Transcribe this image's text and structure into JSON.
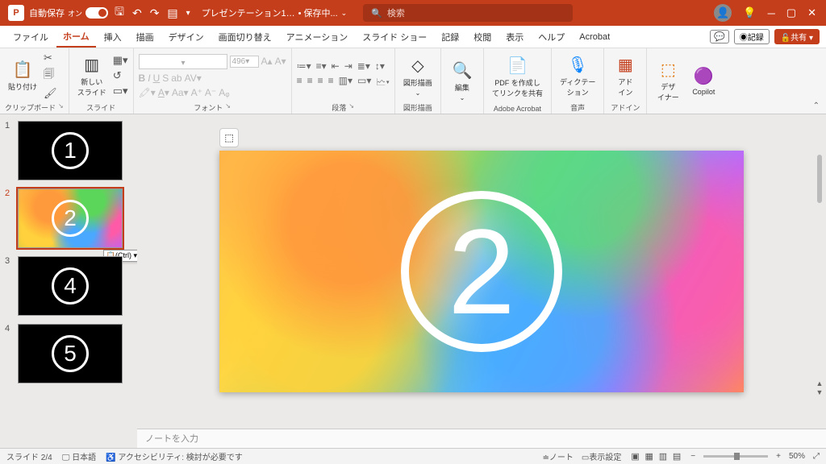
{
  "title_bar": {
    "app_initial": "P",
    "autosave": "自動保存",
    "autosave_state": "オン",
    "doc": "プレゼンテーション1…",
    "saving": "• 保存中...",
    "search_placeholder": "検索"
  },
  "tabs": [
    "ファイル",
    "ホーム",
    "挿入",
    "描画",
    "デザイン",
    "画面切り替え",
    "アニメーション",
    "スライド ショー",
    "記録",
    "校閲",
    "表示",
    "ヘルプ",
    "Acrobat"
  ],
  "active_tab": 1,
  "tab_right": {
    "record": "◉記録",
    "share": "🔓共有"
  },
  "ribbon": {
    "clipboard": {
      "label": "クリップボード",
      "paste": "貼り付け"
    },
    "slides": {
      "label": "スライド",
      "new": "新しい\nスライド"
    },
    "font": {
      "label": "フォント",
      "size": "496"
    },
    "paragraph": {
      "label": "段落"
    },
    "drawing": {
      "label": "図形描画",
      "btn": "図形描画"
    },
    "editing": {
      "btn": "編集"
    },
    "acrobat": {
      "label": "Adobe Acrobat",
      "btn": "PDF を作成し\nてリンクを共有"
    },
    "voice": {
      "label": "音声",
      "btn": "ディクテー\nション"
    },
    "addins": {
      "label": "アドイン",
      "btn": "アド\nイン"
    },
    "designer": {
      "btn": "デザ\nイナー"
    },
    "copilot": {
      "btn": "Copilot"
    }
  },
  "thumbs": [
    {
      "num": "1",
      "digit": "1",
      "sel": false,
      "bokeh": false
    },
    {
      "num": "2",
      "digit": "2",
      "sel": true,
      "bokeh": true
    },
    {
      "num": "3",
      "digit": "4",
      "sel": false,
      "bokeh": false
    },
    {
      "num": "4",
      "digit": "5",
      "sel": false,
      "bokeh": false
    }
  ],
  "paste_tip": "📋(Ctrl) ▾",
  "canvas_digit": "2",
  "notes_placeholder": "ノートを入力",
  "status": {
    "slide": "スライド 2/4",
    "lang": "日本語",
    "a11y": "アクセシビリティ: 検討が必要です",
    "notes_btn": "ノート",
    "display": "表示設定",
    "zoom": "50%"
  }
}
